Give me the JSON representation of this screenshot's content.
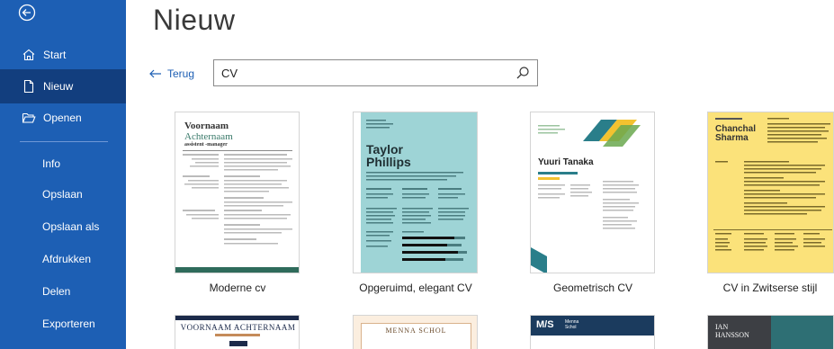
{
  "sidebar": {
    "items": [
      {
        "label": "Start"
      },
      {
        "label": "Nieuw"
      },
      {
        "label": "Openen"
      },
      {
        "label": "Info"
      },
      {
        "label": "Opslaan"
      },
      {
        "label": "Opslaan als"
      },
      {
        "label": "Afdrukken"
      },
      {
        "label": "Delen"
      },
      {
        "label": "Exporteren"
      }
    ]
  },
  "main": {
    "title": "Nieuw",
    "back_label": "Terug",
    "search": {
      "value": "CV"
    }
  },
  "templates": [
    {
      "label": "Moderne cv",
      "first_name": "Voornaam",
      "last_name": "Achternaam",
      "role": "assistent -manager"
    },
    {
      "label": "Opgeruimd, elegant CV",
      "name_line1": "Taylor",
      "name_line2": "Phillips"
    },
    {
      "label": "Geometrisch CV",
      "name": "Yuuri Tanaka"
    },
    {
      "label": "CV in Zwitserse stijl",
      "name_line1": "Chanchal",
      "name_line2": "Sharma"
    }
  ],
  "templates_row2": [
    {
      "title_line1": "VOORNAAM ACHTERNAAM"
    },
    {
      "title_line1": "MENNA SCHOL"
    },
    {
      "initials": "M/S",
      "name_line1": "Menna",
      "name_line2": "Schol"
    },
    {
      "name_line1": "IAN",
      "name_line2": "HANSSON"
    }
  ],
  "colors": {
    "sidebar_bg": "#1d5fb4",
    "sidebar_active": "#123e7e",
    "accent": "#1d5fb4"
  }
}
